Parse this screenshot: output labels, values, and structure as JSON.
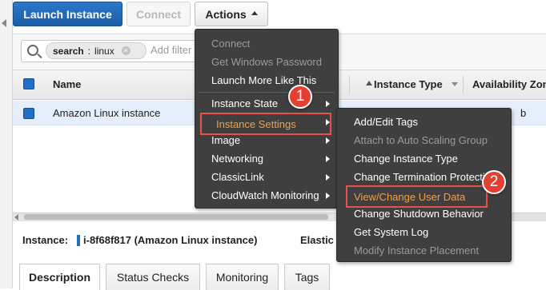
{
  "toolbar": {
    "launch_label": "Launch Instance",
    "connect_label": "Connect",
    "actions_label": "Actions"
  },
  "search": {
    "token_key": "search",
    "token_sep": ":",
    "token_value": "linux",
    "placeholder": "Add filter"
  },
  "table": {
    "columns": [
      "Name",
      "Instance Type",
      "Availability Zone"
    ],
    "rows": [
      {
        "name": "Amazon Linux instance",
        "az_partial": "b"
      }
    ]
  },
  "instance_info": {
    "label": "Instance:",
    "id_text": "i-8f68f817 (Amazon Linux instance)",
    "elastic_label": "Elastic"
  },
  "detail_tabs": [
    "Description",
    "Status Checks",
    "Monitoring",
    "Tags"
  ],
  "actions_menu": {
    "items": [
      {
        "label": "Connect",
        "disabled": true
      },
      {
        "label": "Get Windows Password",
        "disabled": true
      },
      {
        "label": "Launch More Like This",
        "disabled": false
      },
      {
        "label": "Instance State",
        "disabled": false,
        "submenu": true
      },
      {
        "label": "Instance Settings",
        "disabled": false,
        "submenu": true,
        "highlighted": true
      },
      {
        "label": "Image",
        "disabled": false,
        "submenu": true
      },
      {
        "label": "Networking",
        "disabled": false,
        "submenu": true
      },
      {
        "label": "ClassicLink",
        "disabled": false,
        "submenu": true
      },
      {
        "label": "CloudWatch Monitoring",
        "disabled": false,
        "submenu": true
      }
    ]
  },
  "settings_submenu": {
    "items": [
      {
        "label": "Add/Edit Tags",
        "disabled": false
      },
      {
        "label": "Attach to Auto Scaling Group",
        "disabled": true
      },
      {
        "label": "Change Instance Type",
        "disabled": false
      },
      {
        "label": "Change Termination Protection",
        "disabled": false
      },
      {
        "label": "View/Change User Data",
        "disabled": false,
        "highlighted": true
      },
      {
        "label": "Change Shutdown Behavior",
        "disabled": false
      },
      {
        "label": "Get System Log",
        "disabled": false
      },
      {
        "label": "Modify Instance Placement",
        "disabled": true
      }
    ]
  },
  "callouts": {
    "first": "1",
    "second": "2"
  },
  "colors": {
    "primary": "#1f6fc4",
    "menu_bg": "#3f3f3f",
    "highlight_border": "#e8514a",
    "highlight_text": "#f0a04a",
    "callout": "#e53f34"
  },
  "icons": [
    "search-icon",
    "chevron-up-icon",
    "token-close-icon",
    "sort-up-icon",
    "filter-caret-icon",
    "submenu-arrow-icon"
  ]
}
